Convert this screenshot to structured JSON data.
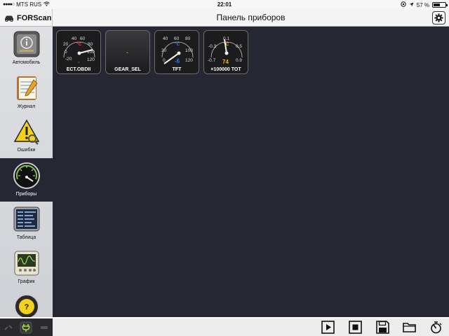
{
  "status": {
    "carrier": "MTS RUS",
    "time": "22:01",
    "battery": "57 %",
    "battery_level": 0.57
  },
  "nav": {
    "brand": "FORScan",
    "title": "Панель приборов"
  },
  "sidebar": {
    "items": [
      {
        "label": "Автомобиль",
        "icon": "car-info-icon"
      },
      {
        "label": "Журнал",
        "icon": "journal-icon"
      },
      {
        "label": "Ошибки",
        "icon": "warning-icon"
      },
      {
        "label": "Приборы",
        "icon": "gauge-icon",
        "active": true
      },
      {
        "label": "Таблица",
        "icon": "table-icon"
      },
      {
        "label": "График",
        "icon": "graph-icon"
      },
      {
        "label": "",
        "icon": "steering-wheel-icon"
      }
    ]
  },
  "gauges": [
    {
      "label": "ECT.OBDII",
      "unit": "°C",
      "ticks": [
        "-20",
        "0",
        "20",
        "40",
        "60",
        "80",
        "100",
        "120"
      ],
      "value_text": "-",
      "unit_color": "#ff3b30",
      "value_color": "#ff3b30"
    },
    {
      "label": "GEAR_SEL",
      "value_text": "-",
      "value_color": "#34c759"
    },
    {
      "label": "TFT",
      "unit": "°C",
      "ticks": [
        "0",
        "20",
        "40",
        "60",
        "80",
        "100",
        "120"
      ],
      "value_text": "-6",
      "unit_color": "#2f7cf6",
      "value_color": "#2f7cf6"
    },
    {
      "label": "×100000 TOT",
      "unit": "°C",
      "ticks": [
        "-0.7",
        "-0.3",
        "0.1",
        "0.5",
        "0.9"
      ],
      "value_text": "74",
      "unit_color": "#f5b400",
      "value_color": "#f5b400"
    }
  ],
  "toolbar": {
    "play": "play-icon",
    "stop": "stop-icon",
    "save": "save-icon",
    "open": "folder-icon",
    "clear": "clear-icon"
  }
}
